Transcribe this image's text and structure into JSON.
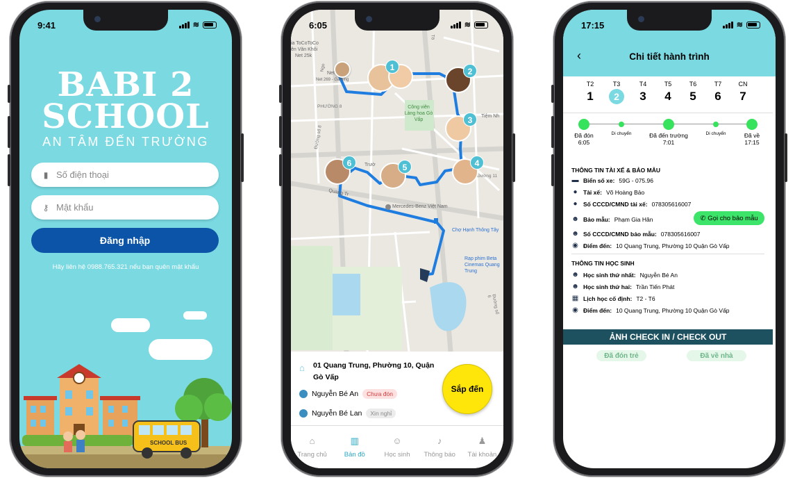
{
  "phone1": {
    "time": "9:41",
    "logo_line1": "BABI 2",
    "logo_line2": "SCHOOL",
    "slogan": "AN TÂM ĐẾN TRƯỜNG",
    "phone_placeholder": "Số điện thoại",
    "password_placeholder": "Mật khẩu",
    "login_label": "Đăng nhập",
    "hint": "Hãy liên hệ 0988.765.321 nếu bạn quên mật khẩu",
    "bus_text": "SCHOOL BUS"
  },
  "phone2": {
    "time": "6:05",
    "map_labels": {
      "to_coco": "ia ToCoToCo",
      "van_khoi": "ên Văn Khôi",
      "speed": "Net 25k",
      "net": "Net 26",
      "gaming": "Net 269 - Gaming",
      "ward8": "PHƯỜNG 8",
      "park": "Công viên Làng hoa Gò Vấp",
      "tiem": "Tiệm Nh",
      "mercedes": "Mercedes-Benz Việt Nam",
      "cho": "Chợ Hạnh Thông Tây",
      "cinema": "Rạp phim Beta Cinemas Quang Trung",
      "quang_trung": "Quang Tr",
      "truong": "Trườ",
      "street11": "Đường 11",
      "street8": "Đường số 8",
      "street6": "Đường số 6",
      "road_to": "Tô",
      "road_ngo": "Ngo"
    },
    "markers": [
      "1",
      "2",
      "3",
      "4",
      "5",
      "6"
    ],
    "address": "01 Quang Trung, Phường 10, Quận Gò Vấp",
    "students": [
      {
        "name": "Nguyễn Bé An",
        "status": "Chưa đón",
        "bg": "#fde0e0",
        "fg": "#d23b3b"
      },
      {
        "name": "Nguyễn Bé Lan",
        "status": "Xin nghỉ",
        "bg": "#ececec",
        "fg": "#888888"
      }
    ],
    "arriving_label": "Sắp đến",
    "tabs": [
      "Trang chủ",
      "Bản đồ",
      "Học sinh",
      "Thông báo",
      "Tài khoản"
    ],
    "active_tab": "Bản đồ"
  },
  "phone3": {
    "time": "17:15",
    "title": "Chi tiết hành trình",
    "days": [
      {
        "label": "T2",
        "num": "1"
      },
      {
        "label": "T3",
        "num": "2"
      },
      {
        "label": "T4",
        "num": "3"
      },
      {
        "label": "T5",
        "num": "4"
      },
      {
        "label": "T6",
        "num": "5"
      },
      {
        "label": "T7",
        "num": "6"
      },
      {
        "label": "CN",
        "num": "7"
      }
    ],
    "selected_day": "T3",
    "timeline": {
      "picked": "Đã đón",
      "picked_time": "6:05",
      "moving1": "Di chuyển",
      "arrived": "Đã đến trường",
      "arrived_time": "7:01",
      "moving2": "Di chuyển",
      "returned": "Đã về",
      "returned_time": "17:15"
    },
    "driver_section": "THÔNG TIN TÀI XẾ & BẢO MẪU",
    "plate_label": "Biển số xe:",
    "plate_value": "59G - 075.96",
    "driver_label": "Tài xế:",
    "driver_value": "Võ Hoàng Bảo",
    "driver_id_label": "Số CCCD/CMND tài xế:",
    "driver_id_value": "078305616007",
    "nanny_label": "Bảo mẫu:",
    "nanny_value": "Phạm Gia Hân",
    "call_label": "Gọi cho bảo mẫu",
    "nanny_id_label": "Số CCCD/CMND bảo mẫu:",
    "nanny_id_value": "078305616007",
    "dest_label": "Điểm đến:",
    "dest_value": "10 Quang Trung, Phường 10 Quận Gò Vấp",
    "student_section": "THÔNG TIN HỌC SINH",
    "s1_label": "Học sinh thứ nhất:",
    "s1_value": "Nguyễn Bé An",
    "s2_label": "Học sinh thứ hai:",
    "s2_value": "Trần Tiến Phát",
    "sched_label": "Lịch học cố định:",
    "sched_value": "T2 - T6",
    "dest2_label": "Điểm đến:",
    "dest2_value": "10 Quang Trung, Phường 10 Quận Gò Vấp",
    "checkin_title": "ẢNH CHECK IN / CHECK OUT",
    "picked_btn": "Đã đón trẻ",
    "home_btn": "Đã về nhà"
  }
}
